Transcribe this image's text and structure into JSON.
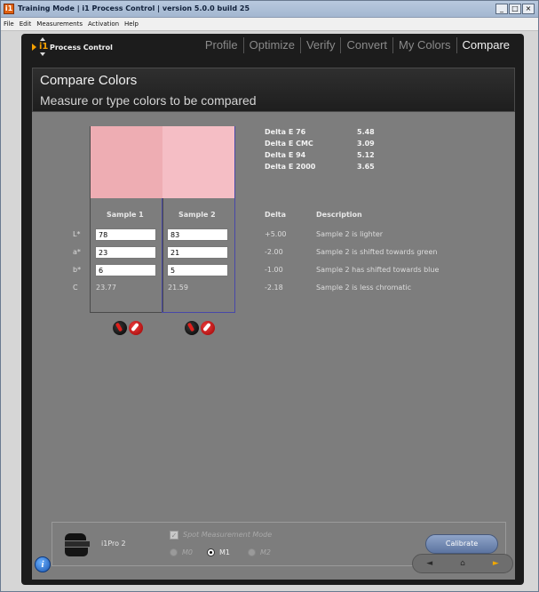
{
  "window": {
    "title": "Training Mode | i1 Process Control | version 5.0.0 build 25",
    "controls": [
      "_",
      "□",
      "×"
    ]
  },
  "menubar": [
    "File",
    "Edit",
    "Measurements",
    "Activation",
    "Help"
  ],
  "app": {
    "logo_mark": "i1",
    "logo_text": "Process Control",
    "nav_tabs": [
      "Profile",
      "Optimize",
      "Verify",
      "Convert",
      "My Colors",
      "Compare"
    ],
    "active_tab": "Compare"
  },
  "header": {
    "title": "Compare Colors",
    "subtitle": "Measure or type colors to be compared"
  },
  "samples": {
    "sample1": {
      "label": "Sample 1",
      "color": "#eeadb3",
      "L": "78",
      "a": "23",
      "b": "6",
      "C": "23.77"
    },
    "sample2": {
      "label": "Sample 2",
      "color": "#f5bec5",
      "L": "83",
      "a": "21",
      "b": "5",
      "C": "21.59"
    }
  },
  "row_labels": {
    "L": "L*",
    "a": "a*",
    "b": "b*",
    "C": "C"
  },
  "delta_e": [
    {
      "label": "Delta E 76",
      "value": "5.48"
    },
    {
      "label": "Delta E CMC",
      "value": "3.09"
    },
    {
      "label": "Delta E 94",
      "value": "5.12"
    },
    {
      "label": "Delta E 2000",
      "value": "3.65"
    }
  ],
  "table": {
    "delta_header": "Delta",
    "desc_header": "Description",
    "rows": [
      {
        "delta": "+5.00",
        "desc": "Sample 2 is lighter"
      },
      {
        "delta": "-2.00",
        "desc": "Sample 2 is shifted towards green"
      },
      {
        "delta": "-1.00",
        "desc": "Sample 2 has shifted towards blue"
      },
      {
        "delta": "-2.18",
        "desc": "Sample 2 is less chromatic"
      }
    ]
  },
  "device": {
    "name": "i1Pro 2",
    "spot_mode_label": "Spot Measurement Mode",
    "modes": [
      "M0",
      "M1",
      "M2"
    ],
    "selected_mode": "M1",
    "calibrate_label": "Calibrate"
  },
  "footer": {
    "info_glyph": "i",
    "nav_glyphs": [
      "◄",
      "⌂",
      "►"
    ]
  }
}
